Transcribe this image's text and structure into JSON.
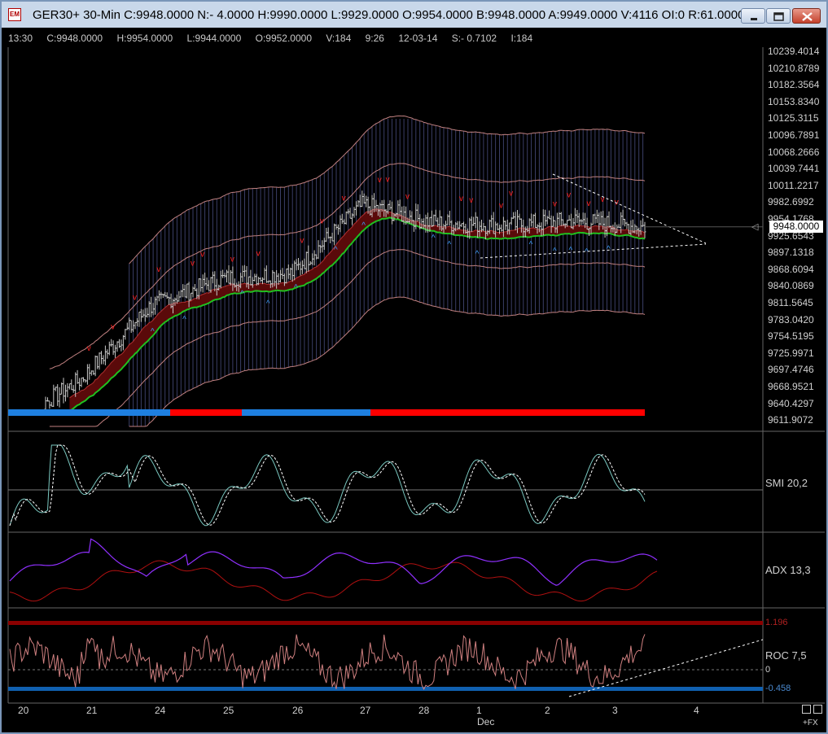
{
  "window": {
    "title": "GER30+ 30-Min C:9948.0000 N:- 4.0000 H:9990.0000 L:9929.0000 O:9954.0000 B:9948.0000 A:9949.0000 V:4116 OI:0 R:61.0000",
    "icon_name": "app-chart-icon",
    "buttons": [
      "minimize-icon",
      "maximize-icon",
      "close-icon"
    ]
  },
  "info_line": [
    "13:30",
    "C:9948.0000",
    "H:9954.0000",
    "L:9944.0000",
    "O:9952.0000",
    "V:184",
    "9:26",
    "12-03-14",
    "S:- 0.7102",
    "I:184"
  ],
  "price_axis": [
    "10239.4014",
    "10210.8789",
    "10182.3564",
    "10153.8340",
    "10125.3115",
    "10096.7891",
    "10068.2666",
    "10039.7441",
    "10011.2217",
    "9982.6992",
    "9954.1768",
    "9925.6543",
    "9897.1318",
    "9868.6094",
    "9840.0869",
    "9811.5645",
    "9783.0420",
    "9754.5195",
    "9725.9971",
    "9697.4746",
    "9668.9521",
    "9640.4297",
    "9611.9072"
  ],
  "current_price": "9948.0000",
  "panels": {
    "smi": {
      "label": "SMI  20,2"
    },
    "adx": {
      "label": "ADX  13,3"
    },
    "roc": {
      "label": "ROC  7,5",
      "upper": "1.196",
      "zero": "0",
      "lower": "-0.458"
    }
  },
  "date_axis": {
    "ticks": [
      "20",
      "21",
      "24",
      "25",
      "26",
      "27",
      "28",
      "1",
      "2",
      "3",
      "4"
    ],
    "month": "Dec"
  },
  "footer": {
    "fx": "+FX"
  },
  "colors": {
    "background": "#000000",
    "candles": "#c8c8c8",
    "sell_arrows": "#ff2020",
    "buy_arrows": "#3ca0ff",
    "band": "#c08080",
    "ma_green": "#20c020",
    "regime_blue": "#1e7fe0",
    "regime_red": "#ff0000",
    "adx_blue": "#9030ff",
    "adx_red": "#b01010",
    "roc_line": "#d08080",
    "roc_upper": "#8a0000",
    "roc_lower": "#1060b0"
  },
  "chart_data": {
    "type": "line",
    "title": "GER30+ 30-Min",
    "xlabel": "",
    "ylabel": "",
    "ylim": [
      9611.9072,
      10239.4014
    ],
    "grid": false,
    "x": [
      "20",
      "21",
      "24",
      "25",
      "26",
      "27",
      "28",
      "1",
      "2",
      "3"
    ],
    "series": [
      {
        "values": [
          9615,
          9690,
          9815,
          9860,
          9870,
          9985,
          9955,
          9950,
          9958,
          9948
        ]
      }
    ],
    "regime_bar": [
      "blue",
      "blue",
      "red",
      "blue",
      "blue",
      "red",
      "red",
      "red",
      "red",
      "red"
    ]
  }
}
